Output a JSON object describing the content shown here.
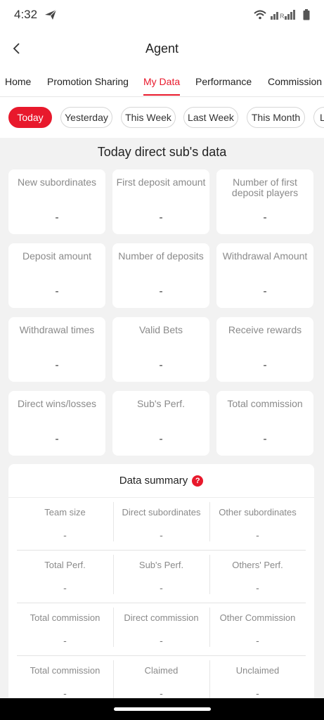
{
  "status_bar": {
    "time": "4:32"
  },
  "header": {
    "title": "Agent"
  },
  "tabs": [
    {
      "label": "Home"
    },
    {
      "label": "Promotion Sharing"
    },
    {
      "label": "My Data"
    },
    {
      "label": "Performance"
    },
    {
      "label": "Commission"
    }
  ],
  "filters": [
    {
      "label": "Today"
    },
    {
      "label": "Yesterday"
    },
    {
      "label": "This Week"
    },
    {
      "label": "Last Week"
    },
    {
      "label": "This Month"
    },
    {
      "label": "L"
    }
  ],
  "section_title": "Today direct sub's data",
  "stats": [
    {
      "label": "New subordinates",
      "value": "-"
    },
    {
      "label": "First deposit amount",
      "value": "-"
    },
    {
      "label": "Number of first deposit players",
      "value": "-"
    },
    {
      "label": "Deposit amount",
      "value": "-"
    },
    {
      "label": "Number of deposits",
      "value": "-"
    },
    {
      "label": "Withdrawal Amount",
      "value": "-"
    },
    {
      "label": "Withdrawal times",
      "value": "-"
    },
    {
      "label": "Valid Bets",
      "value": "-"
    },
    {
      "label": "Receive rewards",
      "value": "-"
    },
    {
      "label": "Direct wins/losses",
      "value": "-"
    },
    {
      "label": "Sub's Perf.",
      "value": "-"
    },
    {
      "label": "Total commission",
      "value": "-"
    }
  ],
  "summary": {
    "title": "Data summary",
    "help_glyph": "?",
    "rows": [
      [
        {
          "label": "Team size",
          "value": "-"
        },
        {
          "label": "Direct subordinates",
          "value": "-"
        },
        {
          "label": "Other subordinates",
          "value": "-"
        }
      ],
      [
        {
          "label": "Total Perf.",
          "value": "-"
        },
        {
          "label": "Sub's Perf.",
          "value": "-"
        },
        {
          "label": "Others' Perf.",
          "value": "-"
        }
      ],
      [
        {
          "label": "Total commission",
          "value": "-"
        },
        {
          "label": "Direct commission",
          "value": "-"
        },
        {
          "label": "Other Commission",
          "value": "-"
        }
      ],
      [
        {
          "label": "Total commission",
          "value": "-"
        },
        {
          "label": "Claimed",
          "value": "-"
        },
        {
          "label": "Unclaimed",
          "value": "-"
        }
      ]
    ]
  },
  "colors": {
    "accent": "#e8192c",
    "background": "#f2f2f2",
    "card": "#ffffff",
    "label": "#8a8a8a"
  },
  "icons": [
    "send-icon",
    "wifi-icon",
    "signal-icon",
    "battery-icon",
    "back-arrow-icon",
    "help-icon"
  ]
}
